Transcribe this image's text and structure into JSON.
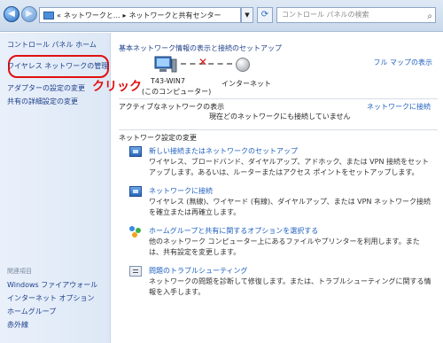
{
  "address_bar": {
    "back_icon": "back-arrow-icon",
    "forward_icon": "forward-arrow-icon",
    "breadcrumb_prefix": "«",
    "crumb1": "ネットワークと...",
    "crumb_sep": "▸",
    "crumb2": "ネットワークと共有センター",
    "search_placeholder": "コントロール パネルの検索"
  },
  "sidebar": {
    "home": "コントロール パネル ホーム",
    "items": [
      {
        "label": "ワイヤレス ネットワークの管理"
      },
      {
        "label": "アダプターの設定の変更"
      },
      {
        "label": "共有の詳細設定の変更"
      }
    ],
    "related_heading": "関連項目",
    "related": [
      {
        "label": "Windows ファイアウォール"
      },
      {
        "label": "インターネット オプション"
      },
      {
        "label": "ホームグループ"
      },
      {
        "label": "赤外線"
      }
    ]
  },
  "main": {
    "title": "基本ネットワーク情報の表示と接続のセットアップ",
    "full_map": "フル マップの表示",
    "pc_name": "T43-WIN7",
    "pc_label": "(このコンピューター)",
    "internet_label": "インターネット",
    "annotation": "クリック",
    "active_networks_label": "アクティブなネットワークの表示",
    "connect_link": "ネットワークに接続",
    "no_network": "現在どのネットワークにも接続していません",
    "settings_label": "ネットワーク設定の変更",
    "tasks": [
      {
        "link": "新しい接続またはネットワークのセットアップ",
        "desc": "ワイヤレス、ブロードバンド、ダイヤルアップ、アドホック、または VPN 接続をセットアップします。あるいは、ルーターまたはアクセス ポイントをセットアップします。"
      },
      {
        "link": "ネットワークに接続",
        "desc": "ワイヤレス (無線)、ワイヤード (有線)、ダイヤルアップ、または VPN ネットワーク接続を確立または再確立します。"
      },
      {
        "link": "ホームグループと共有に関するオプションを選択する",
        "desc": "他のネットワーク コンピューター上にあるファイルやプリンターを利用します。または、共有設定を変更します。"
      },
      {
        "link": "問題のトラブルシューティング",
        "desc": "ネットワークの問題を診断して修復します。または、トラブルシューティングに関する情報を入手します。"
      }
    ]
  },
  "colors": {
    "link": "#1d5fbf",
    "annotation": "#e01010",
    "sidebar_bg": "#e9f0fa"
  }
}
